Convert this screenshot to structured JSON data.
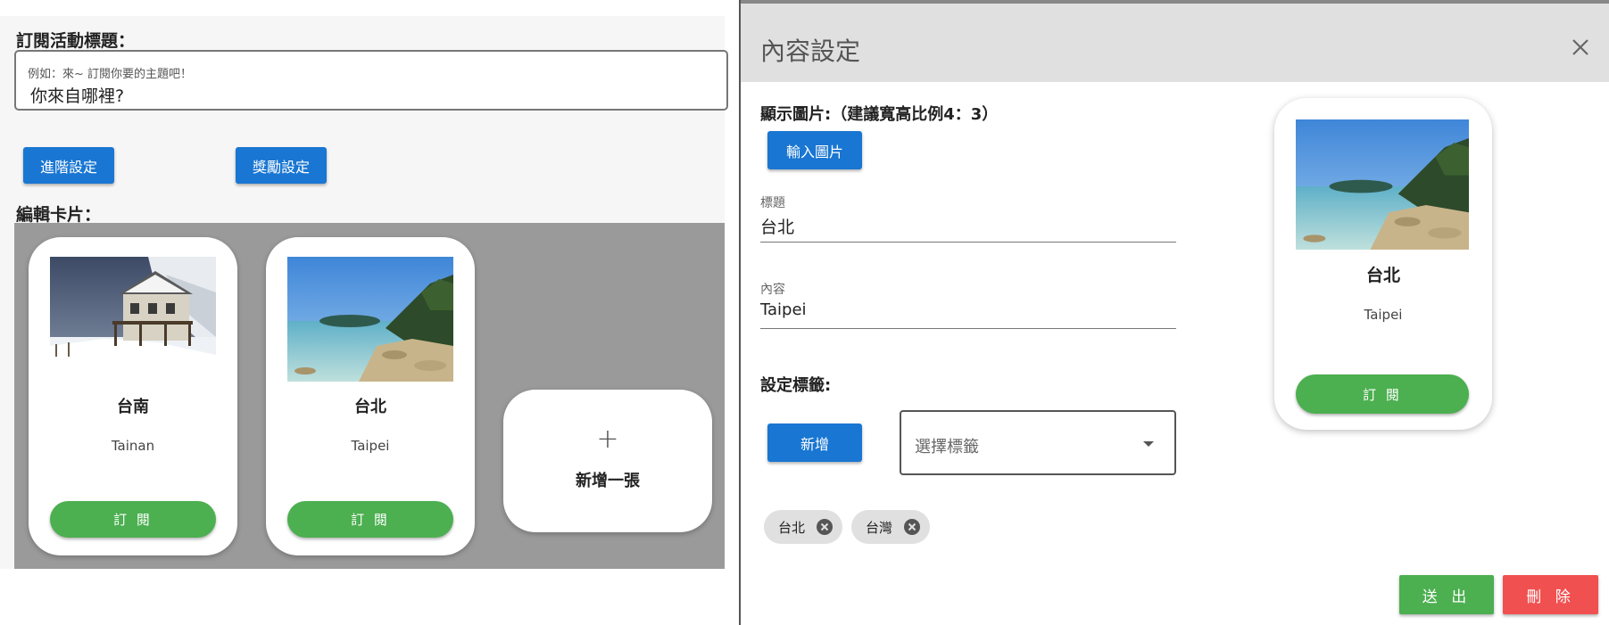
{
  "left": {
    "subscription_title_label": "訂閱活動標題：",
    "title_input": {
      "hint": "例如：來~ 訂閱你要的主題吧！",
      "value": "你來自哪裡?"
    },
    "advanced_button": "進階設定",
    "reward_button": "獎勵設定",
    "edit_cards_label": "編輯卡片：",
    "cards": [
      {
        "title": "台南",
        "subtitle": "Tainan",
        "button": "訂 閱"
      },
      {
        "title": "台北",
        "subtitle": "Taipei",
        "button": "訂 閱"
      }
    ],
    "add_card": {
      "plus": "+",
      "label": "新增一張"
    }
  },
  "dialog": {
    "title": "內容設定",
    "image_label": "顯示圖片:（建議寬高比例4：3）",
    "upload_button": "輸入圖片",
    "title_field": {
      "label": "標題",
      "value": "台北"
    },
    "content_field": {
      "label": "內容",
      "value": "Taipei"
    },
    "tags_label": "設定標籤:",
    "add_tag_button": "新增",
    "tag_select_placeholder": "選擇標籤",
    "tags": [
      "台北",
      "台灣"
    ],
    "preview": {
      "title": "台北",
      "subtitle": "Taipei",
      "button": "訂 閱"
    },
    "submit_button": "送 出",
    "delete_button": "刪 除"
  },
  "colors": {
    "primary_blue": "#1976d2",
    "success_green": "#4caf50",
    "danger_red": "#f05050",
    "cards_area_gray": "#9a9a9a",
    "dialog_header_gray": "#e0e0e0"
  },
  "icons": {
    "close": "close-icon",
    "chip_remove": "cancel-circle-icon",
    "dropdown": "caret-down-icon",
    "add": "plus-icon"
  }
}
